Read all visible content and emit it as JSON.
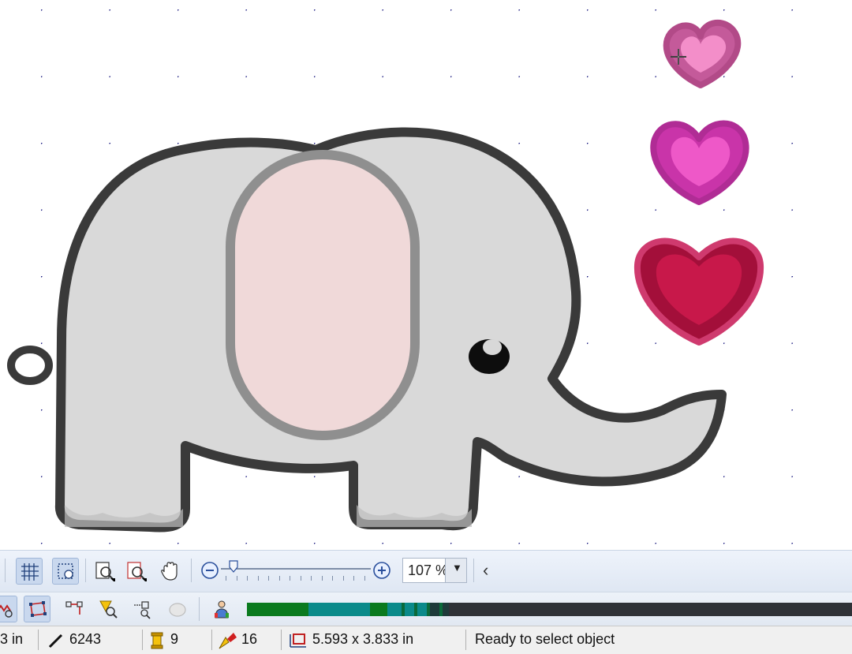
{
  "canvas": {
    "hearts": [
      {
        "name": "light-pink",
        "fill": "#f38ec9",
        "stitch": "#d9579f"
      },
      {
        "name": "magenta",
        "fill": "#ee58c8",
        "stitch": "#c934a9"
      },
      {
        "name": "crimson",
        "fill": "#c8184a",
        "stitch": "#a30f3a"
      }
    ],
    "elephant": {
      "body_color": "#d9d9d9",
      "outline_color": "#3a3a3a",
      "ear_color": "#f0d9d9"
    }
  },
  "toolbar1": {
    "icons": [
      "grid-icon",
      "show-hoop-icon",
      "zoom-window-icon",
      "zoom-selection-icon",
      "pan-hand-icon",
      "zoom-out-icon",
      "zoom-in-icon"
    ],
    "zoom_value": "107 %",
    "zoom_level": 107,
    "scroll_left_glyph": "‹"
  },
  "toolbar2": {
    "icons": [
      "stitch-view-icon",
      "reshape-icon",
      "connector-icon",
      "color-select-icon",
      "branching-icon",
      "object-color-icon",
      "thread-person-icon"
    ],
    "stitch_bar_colors": [
      "#0a7a1e",
      "#0a8a8a",
      "#0a7a1e",
      "#0a8a8a",
      "#1e3a3a"
    ]
  },
  "status": {
    "width_partial": "3 in",
    "stitch_count": "6243",
    "color_count": "9",
    "object_count": "16",
    "design_size": "5.593 x 3.833 in",
    "message": "Ready to select object"
  }
}
